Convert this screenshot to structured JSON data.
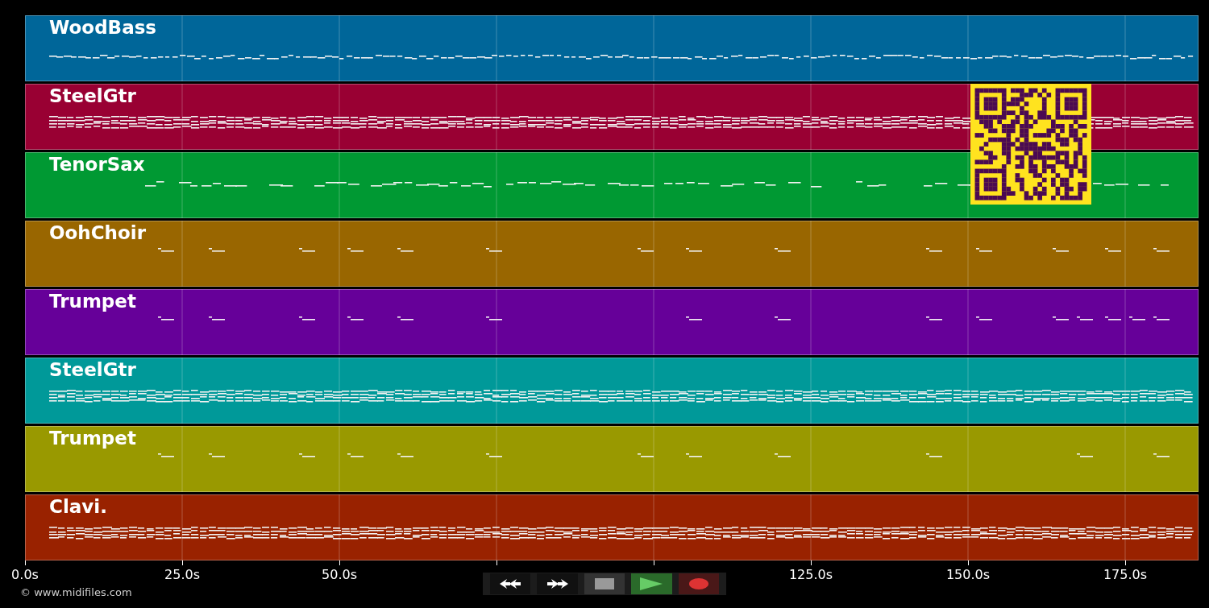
{
  "tracks": [
    {
      "name": "WoodBass",
      "color": "#006699",
      "kind": "bass"
    },
    {
      "name": "SteelGtr",
      "color": "#990033",
      "kind": "chords"
    },
    {
      "name": "TenorSax",
      "color": "#009933",
      "kind": "melody"
    },
    {
      "name": "OohChoir",
      "color": "#996600",
      "kind": "phrases"
    },
    {
      "name": "Trumpet",
      "color": "#660099",
      "kind": "phrases"
    },
    {
      "name": "SteelGtr",
      "color": "#009999",
      "kind": "chords"
    },
    {
      "name": "Trumpet",
      "color": "#999900",
      "kind": "phrases"
    },
    {
      "name": "Clavi.",
      "color": "#992200",
      "kind": "chords"
    }
  ],
  "overlay": {
    "kind": "qr-code"
  },
  "axis": {
    "ticks": [
      {
        "kind": "labeled",
        "label": "0.0s"
      },
      {
        "kind": "labeled",
        "label": "25.0s"
      },
      {
        "kind": "labeled",
        "label": "50.0s"
      },
      {
        "kind": "plain"
      },
      {
        "kind": "plain"
      },
      {
        "kind": "labeled",
        "label": "125.0s"
      },
      {
        "kind": "labeled",
        "label": "150.0s"
      },
      {
        "kind": "labeled",
        "label": "175.0s"
      }
    ]
  },
  "credit": "© www.midifiles.com",
  "transport": [
    {
      "kind": "rewind"
    },
    {
      "kind": "forward"
    },
    {
      "kind": "stop"
    },
    {
      "kind": "play"
    },
    {
      "kind": "record"
    }
  ]
}
